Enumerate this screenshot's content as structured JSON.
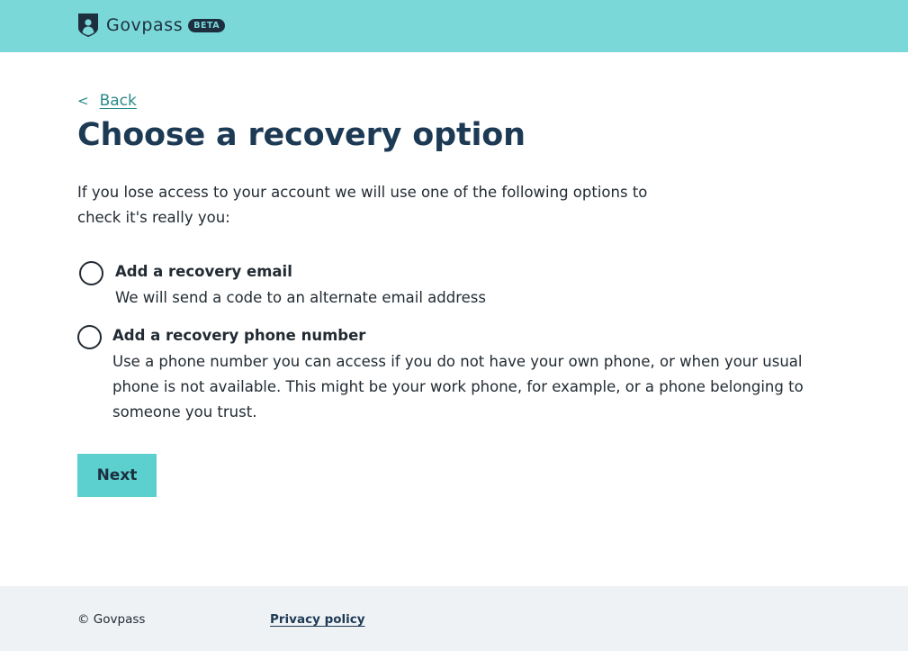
{
  "header": {
    "brand_name": "Govpass",
    "badge": "BETA",
    "background_color": "#7bd8d8",
    "logo_icon": "shield-icon"
  },
  "nav": {
    "back_icon": "<",
    "back_label": "Back"
  },
  "page": {
    "title": "Choose a recovery option",
    "intro": "If you lose access to your account we will use one of the following options to check it's really you:"
  },
  "options": [
    {
      "title": "Add a recovery email",
      "description": "We will send a code to an alternate email address",
      "selected": false
    },
    {
      "title": "Add a recovery phone number",
      "description": "Use a phone number you can access if you do not have your own phone, or when your usual phone is not available. This might be your work phone, for example, or a phone belonging to someone you trust.",
      "selected": false
    }
  ],
  "actions": {
    "next_label": "Next",
    "next_color": "#5ccfcf"
  },
  "footer": {
    "copyright": "© Govpass",
    "privacy_label": "Privacy policy"
  }
}
